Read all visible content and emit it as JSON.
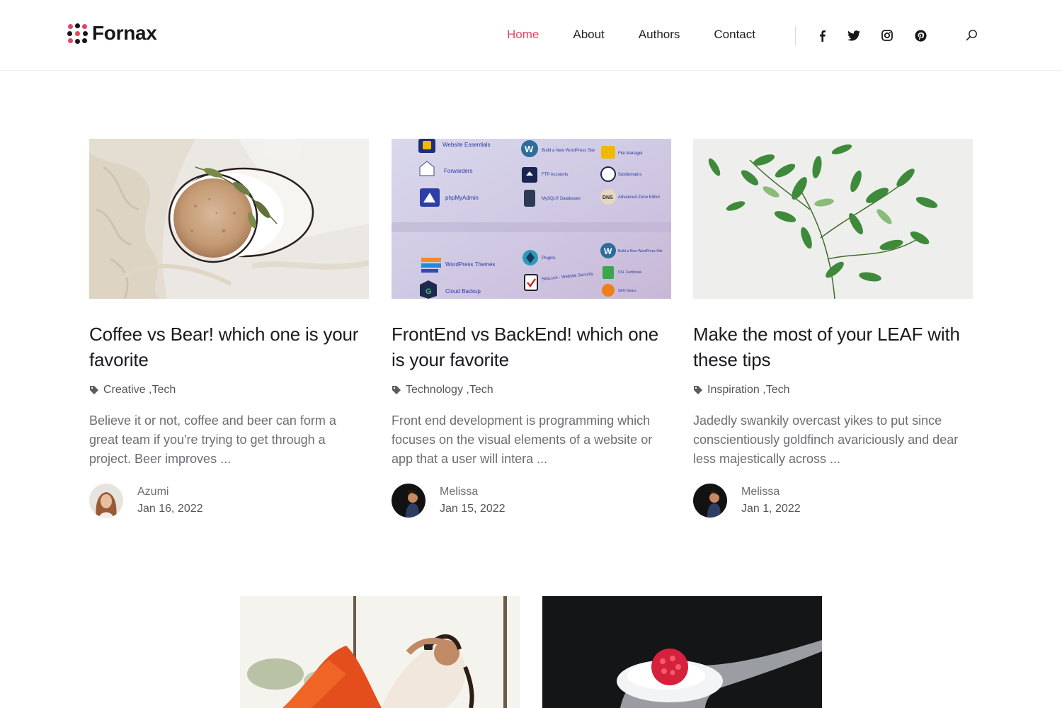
{
  "brand": {
    "name": "Fornax",
    "accent": "#e84364",
    "dots": [
      "#e84364",
      "#16161c"
    ]
  },
  "nav": {
    "items": [
      {
        "label": "Home",
        "active": true
      },
      {
        "label": "About",
        "active": false
      },
      {
        "label": "Authors",
        "active": false
      },
      {
        "label": "Contact",
        "active": false
      }
    ],
    "social_icons": [
      "facebook-icon",
      "twitter-icon",
      "instagram-icon",
      "pinterest-icon"
    ],
    "search_icon": "search-icon"
  },
  "posts": [
    {
      "title": "Coffee vs Bear! which one is your favorite",
      "categories": "Creative ,Tech",
      "excerpt": "Believe it or not, coffee and beer can form a great team if you're trying to get through a project. Beer improves ...",
      "author": "Azumi",
      "date": "Jan 16, 2022"
    },
    {
      "title": "FrontEnd vs BackEnd! which one is your favorite",
      "categories": "Technology ,Tech",
      "excerpt": "Front end development is programming which focuses on the visual elements of a website or app that a user will intera ...",
      "author": "Melissa",
      "date": "Jan 15, 2022"
    },
    {
      "title": "Make the most of your LEAF with these tips",
      "categories": "Inspiration ,Tech",
      "excerpt": "Jadedly swankily overcast yikes to put since conscientiously goldfinch avariciously and dear less majestically across ...",
      "author": "Melissa",
      "date": "Jan 1, 2022"
    }
  ],
  "screen_panel_labels": {
    "left": [
      "Website Essentials",
      "Forwarders",
      "phpMyAdmin",
      "WordPress Themes",
      "Cloud Backup"
    ],
    "middle": [
      "Build a New WordPress Site",
      "FTP Accounts",
      "MySQL® Databases",
      "Plugins",
      "SiteLock - Website Security"
    ],
    "right": [
      "File Manager",
      "Subdomains",
      "Advanced Zone Editor",
      "Build a New WordPress Site",
      "SSL Certificate",
      "SEO Gears"
    ]
  }
}
